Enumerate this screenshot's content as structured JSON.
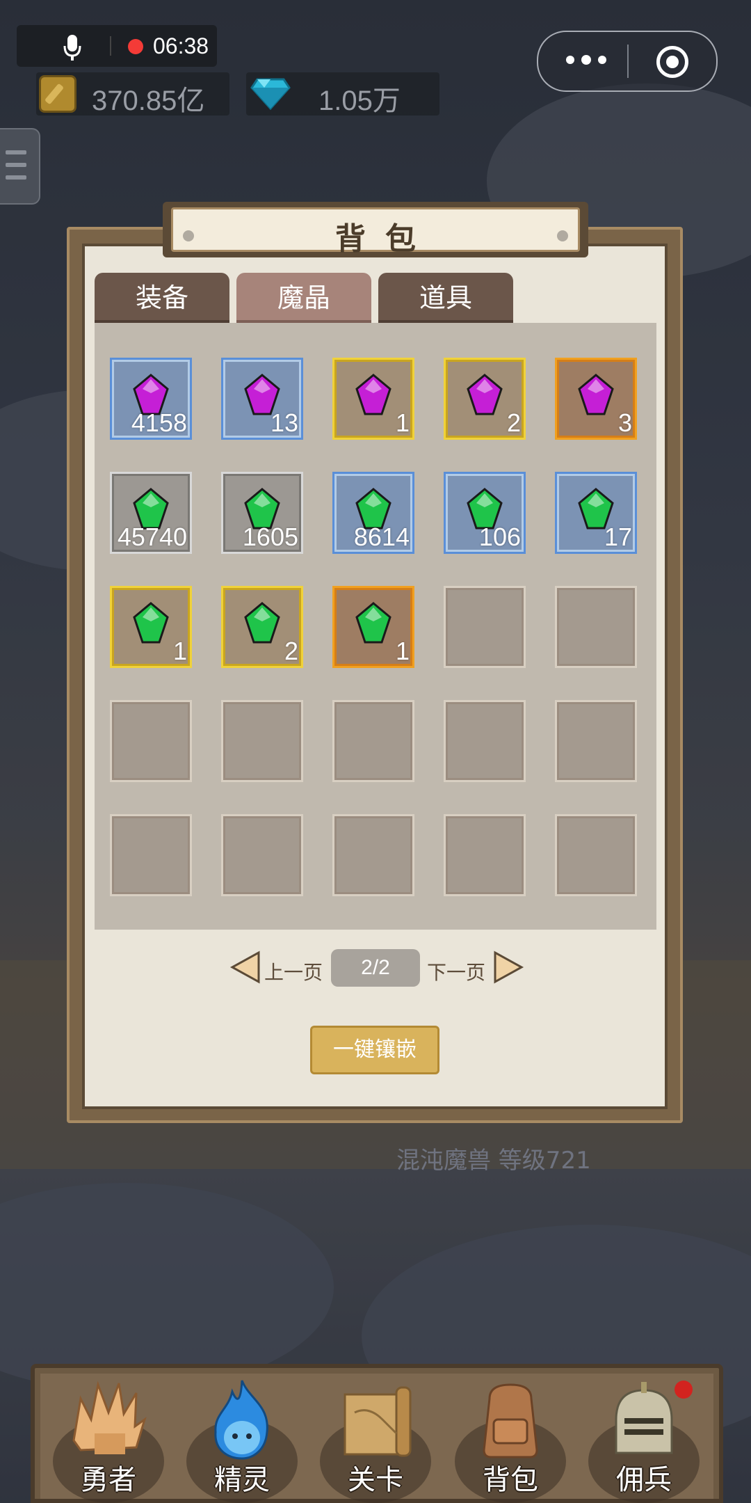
{
  "status": {
    "recording_time": "06:38"
  },
  "currency": {
    "gold": "370.85亿",
    "diamond": "1.05万"
  },
  "panel": {
    "title": "背包",
    "tabs": [
      "装备",
      "魔晶",
      "道具"
    ],
    "active_tab": "魔晶",
    "slots": [
      {
        "rarity": "blue",
        "gem": "purple",
        "count": "4158"
      },
      {
        "rarity": "blue",
        "gem": "purple",
        "count": "13"
      },
      {
        "rarity": "yellow",
        "gem": "purple",
        "count": "1"
      },
      {
        "rarity": "yellow",
        "gem": "purple",
        "count": "2"
      },
      {
        "rarity": "orange",
        "gem": "purple",
        "count": "3"
      },
      {
        "rarity": "gray",
        "gem": "green",
        "count": "45740"
      },
      {
        "rarity": "gray",
        "gem": "green",
        "count": "1605"
      },
      {
        "rarity": "blue",
        "gem": "green",
        "count": "8614"
      },
      {
        "rarity": "blue",
        "gem": "green",
        "count": "106"
      },
      {
        "rarity": "blue",
        "gem": "green",
        "count": "17"
      },
      {
        "rarity": "yellow",
        "gem": "green",
        "count": "1"
      },
      {
        "rarity": "yellow",
        "gem": "green",
        "count": "2"
      },
      {
        "rarity": "orange",
        "gem": "green",
        "count": "1"
      },
      {
        "rarity": "empty",
        "gem": "",
        "count": ""
      },
      {
        "rarity": "empty",
        "gem": "",
        "count": ""
      },
      {
        "rarity": "empty",
        "gem": "",
        "count": ""
      },
      {
        "rarity": "empty",
        "gem": "",
        "count": ""
      },
      {
        "rarity": "empty",
        "gem": "",
        "count": ""
      },
      {
        "rarity": "empty",
        "gem": "",
        "count": ""
      },
      {
        "rarity": "empty",
        "gem": "",
        "count": ""
      },
      {
        "rarity": "empty",
        "gem": "",
        "count": ""
      },
      {
        "rarity": "empty",
        "gem": "",
        "count": ""
      },
      {
        "rarity": "empty",
        "gem": "",
        "count": ""
      },
      {
        "rarity": "empty",
        "gem": "",
        "count": ""
      },
      {
        "rarity": "empty",
        "gem": "",
        "count": ""
      }
    ],
    "pager": {
      "prev": "上一页",
      "page": "2/2",
      "next": "下一页"
    },
    "embed_button": "一键镶嵌"
  },
  "boss_label": "混沌魔兽 等级721",
  "nav": [
    "勇者",
    "精灵",
    "关卡",
    "背包",
    "佣兵"
  ],
  "colors": {
    "panel_bg": "#eae5d9",
    "gem_purple": "#c51fd6",
    "gem_green": "#1fc44a",
    "button_gold": "#d9b35c"
  }
}
